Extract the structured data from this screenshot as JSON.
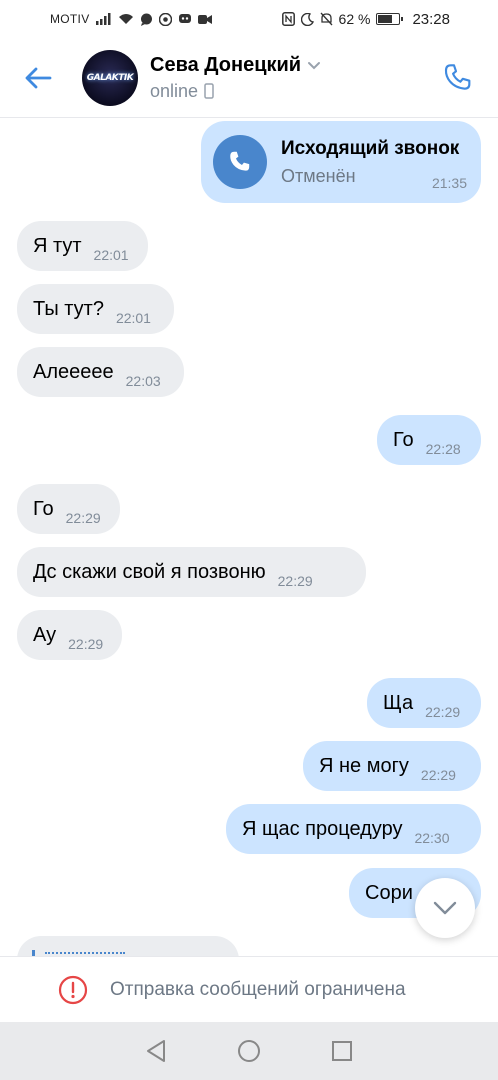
{
  "status_bar": {
    "carrier": "MOTIV",
    "battery": "62 %",
    "battery_level": 0.62,
    "time": "23:28",
    "icons": [
      "signal-icon",
      "wifi-icon",
      "chat-icon",
      "chrome-icon",
      "discord-icon",
      "video-icon",
      "nfc-icon",
      "moon-icon",
      "mute-bell-icon",
      "battery-icon"
    ]
  },
  "header": {
    "contact_name": "Сева Донецкий",
    "status": "online",
    "avatar_text": "GALAKTIK",
    "icons": [
      "back-arrow-icon",
      "chevron-down-icon",
      "mobile-icon",
      "phone-icon"
    ]
  },
  "chat": {
    "call": {
      "title": "Исходящий звонок",
      "status": "Отменён",
      "time": "21:35",
      "icon": "phone-icon"
    },
    "messages": [
      {
        "dir": "in",
        "text": "Я тут",
        "time": "22:01"
      },
      {
        "dir": "in",
        "text": "Ты тут?",
        "time": "22:01"
      },
      {
        "dir": "in",
        "text": "Алеееее",
        "time": "22:03"
      },
      {
        "dir": "out",
        "text": "Го",
        "time": "22:28"
      },
      {
        "dir": "in",
        "text": "Го",
        "time": "22:29"
      },
      {
        "dir": "in",
        "text": "Дс скажи свой я позвоню",
        "time": "22:29"
      },
      {
        "dir": "in",
        "text": "Ау",
        "time": "22:29"
      },
      {
        "dir": "out",
        "text": "Ща",
        "time": "22:29"
      },
      {
        "dir": "out",
        "text": "Я не могу",
        "time": "22:29"
      },
      {
        "dir": "out",
        "text": "Я щас процедуру",
        "time": "22:30"
      },
      {
        "dir": "out",
        "text": "Сори",
        "time": ""
      }
    ],
    "scroll_icon": "chevron-down-icon"
  },
  "restriction": {
    "text": "Отправка сообщений ограничена",
    "icon": "alert-circle-icon"
  },
  "navbar": {
    "icons": [
      "nav-back-icon",
      "nav-home-icon",
      "nav-recents-icon"
    ]
  },
  "colors": {
    "accent": "#4986cc",
    "incoming_bubble": "#ebedf0",
    "outgoing_bubble": "#cce4ff",
    "secondary_text": "#818c99",
    "alert": "#e64646"
  }
}
